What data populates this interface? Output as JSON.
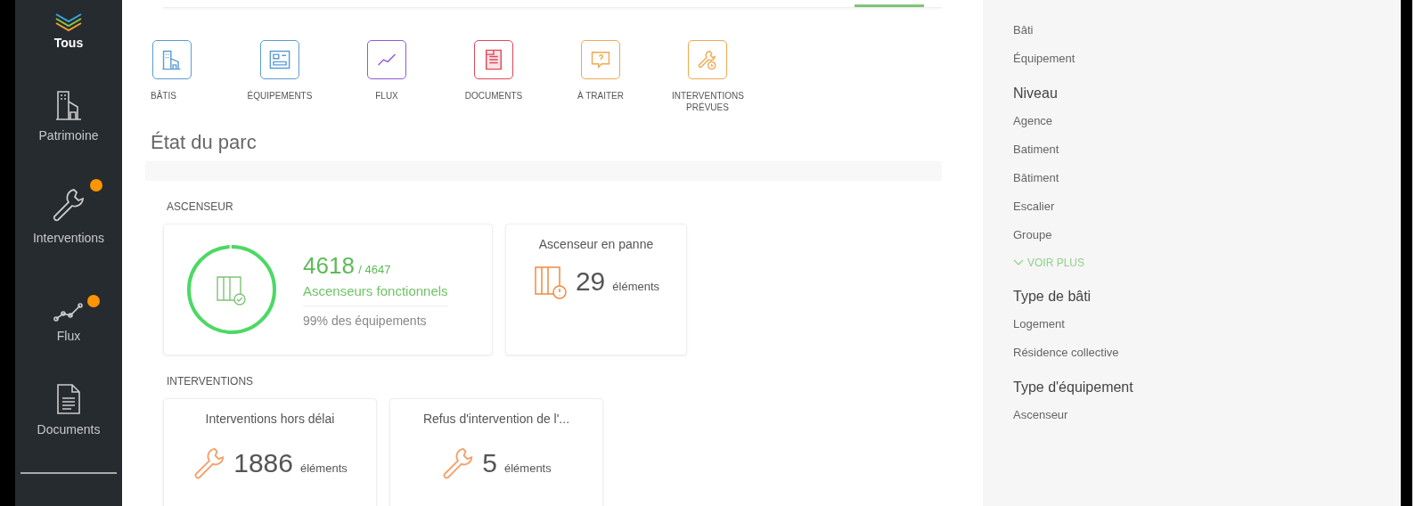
{
  "sidebar": {
    "items": [
      {
        "label": "Tous",
        "selected": true,
        "badge": false
      },
      {
        "label": "Patrimoine",
        "selected": false,
        "badge": false
      },
      {
        "label": "Interventions",
        "selected": false,
        "badge": true
      },
      {
        "label": "Flux",
        "selected": false,
        "badge": true
      },
      {
        "label": "Documents",
        "selected": false,
        "badge": false
      }
    ]
  },
  "shortcuts": [
    {
      "label": "BÂTIS",
      "color": "#5b9bd5"
    },
    {
      "label": "ÉQUIPEMENTS",
      "color": "#5b9bd5"
    },
    {
      "label": "FLUX",
      "color": "#8e5ad8"
    },
    {
      "label": "DOCUMENTS",
      "color": "#e0485a"
    },
    {
      "label": "À TRAITER",
      "color": "#f0a850"
    },
    {
      "label": "INTERVENTIONS PRÉVUES",
      "color": "#f0a850"
    }
  ],
  "title": "État du parc",
  "sections": [
    {
      "heading": "ASCENSEUR",
      "cards": [
        {
          "kind": "ring",
          "value": "4618",
          "total": "/ 4647",
          "label": "Ascenseurs fonctionnels",
          "note": "99% des équipements",
          "level": 0.99
        },
        {
          "kind": "count",
          "title": "Ascenseur en panne",
          "value": "29",
          "unit": "éléments"
        }
      ]
    },
    {
      "heading": "INTERVENTIONS",
      "cards": [
        {
          "kind": "count",
          "title": "Interventions hors délai",
          "value": "1886",
          "unit": "éléments"
        },
        {
          "kind": "count",
          "title": "Refus d'intervention de l'...",
          "value": "5",
          "unit": "éléments"
        }
      ]
    }
  ],
  "filters": [
    {
      "options": [
        "Bâti",
        "Équipement"
      ]
    },
    {
      "heading": "Niveau",
      "options": [
        "Agence",
        "Batiment",
        "Bâtiment",
        "Escalier",
        "Groupe"
      ],
      "more": "VOIR PLUS"
    },
    {
      "heading": "Type de bâti",
      "options": [
        "Logement",
        "Résidence collective"
      ]
    },
    {
      "heading": "Type d'équipement",
      "options": [
        "Ascenseur"
      ]
    }
  ]
}
